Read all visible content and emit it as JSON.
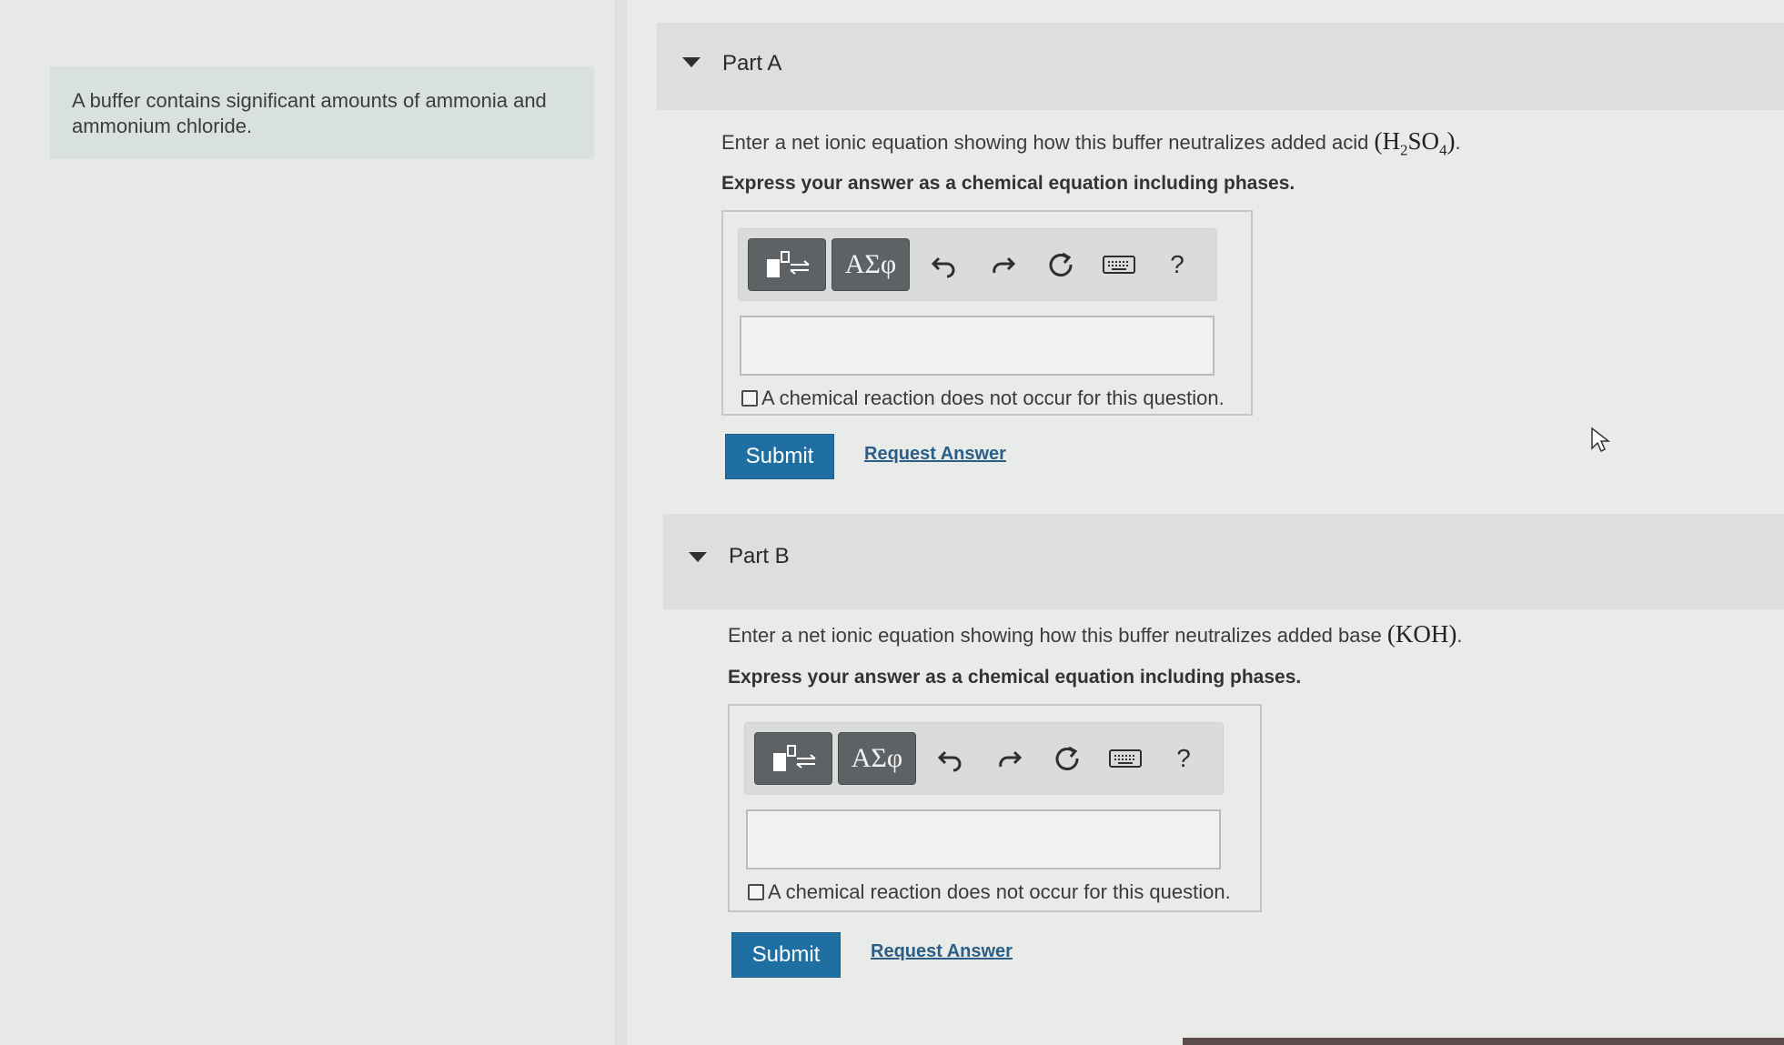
{
  "intro": {
    "text": "A buffer contains significant amounts of ammonia and ammonium chloride."
  },
  "toolbar_labels": {
    "symbols_label": "ΑΣφ",
    "help_label": "?"
  },
  "parts": [
    {
      "title": "Part A",
      "question_prefix": "Enter a net ionic equation showing how this buffer neutralizes added acid",
      "formula_open": "(H",
      "formula_sub1": "2",
      "formula_mid": "SO",
      "formula_sub2": "4",
      "formula_close": ")",
      "trailing": ".",
      "instruction": "Express your answer as a chemical equation including phases.",
      "input_value": "",
      "checkbox_label": "A chemical reaction does not occur for this question.",
      "checkbox_checked": false,
      "submit_label": "Submit",
      "request_label": "Request Answer"
    },
    {
      "title": "Part B",
      "question_prefix": "Enter a net ionic equation showing how this buffer neutralizes added base",
      "formula": "(KOH)",
      "trailing": ".",
      "instruction": "Express your answer as a chemical equation including phases.",
      "input_value": "",
      "checkbox_label": "A chemical reaction does not occur for this question.",
      "checkbox_checked": false,
      "submit_label": "Submit",
      "request_label": "Request Answer"
    }
  ],
  "icons": {
    "templates": "templates-icon",
    "undo": "undo-icon",
    "redo": "redo-icon",
    "reset": "reset-icon",
    "keyboard": "keyboard-icon",
    "help": "help-icon",
    "collapse": "caret-down-icon",
    "cursor": "mouse-pointer-icon"
  },
  "colors": {
    "submit": "#1f6fa3",
    "link": "#2a5e86",
    "toolbar_button": "#5e6264",
    "intro_bg": "#d8e1de"
  }
}
